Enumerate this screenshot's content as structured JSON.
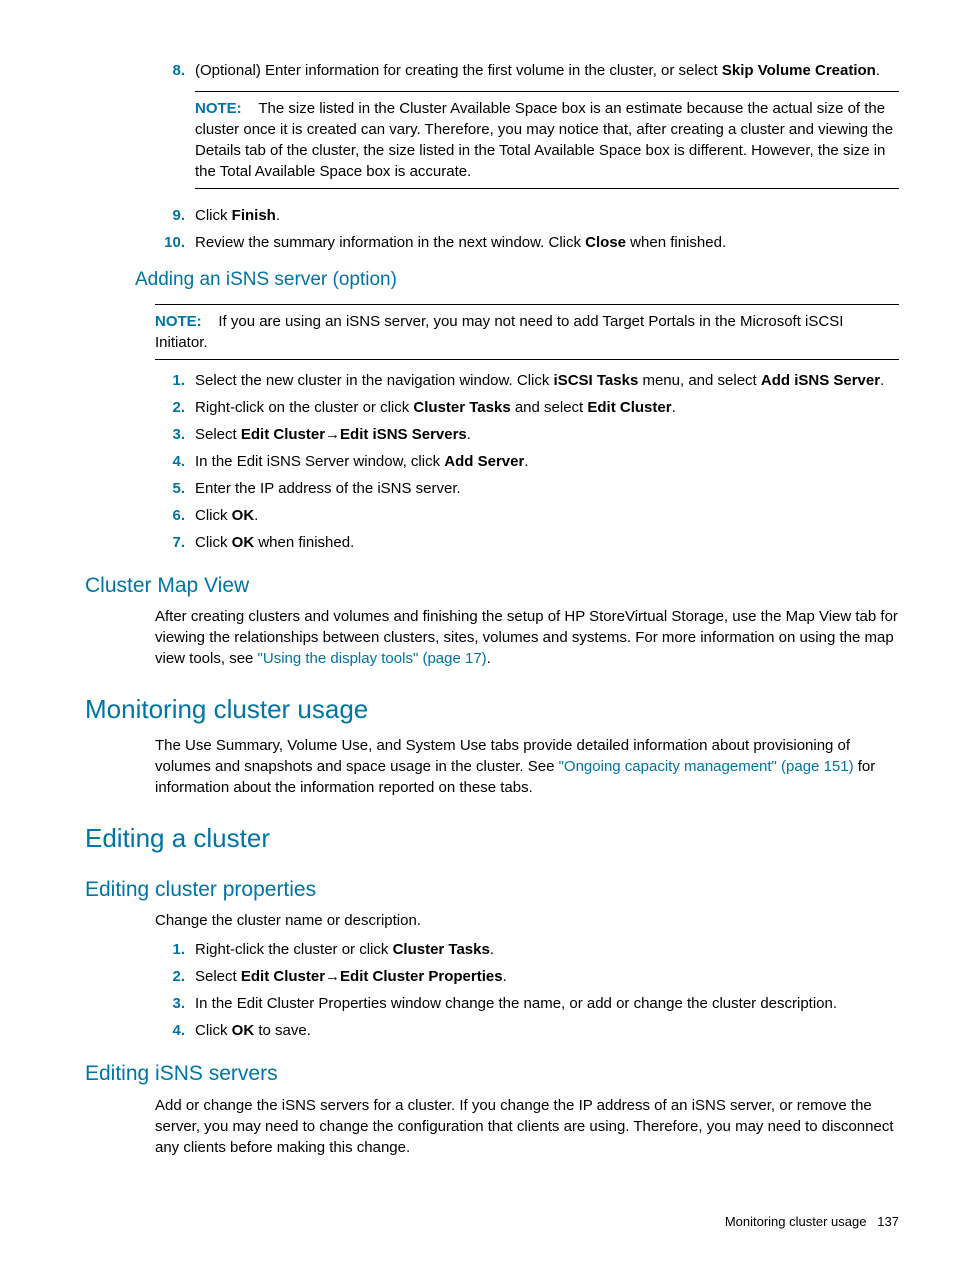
{
  "step8": {
    "num": "8.",
    "pre": "(Optional) Enter information for creating the first volume in the cluster, or select ",
    "bold": "Skip Volume Creation",
    "post": "."
  },
  "note1": {
    "label": "NOTE:",
    "text": "The size listed in the Cluster Available Space box is an estimate because the actual size of the cluster once it is created can vary. Therefore, you may notice that, after creating a cluster and viewing the Details tab of the cluster, the size listed in the Total Available Space box is different. However, the size in the Total Available Space box is accurate."
  },
  "step9": {
    "num": "9.",
    "pre": "Click ",
    "bold": "Finish",
    "post": "."
  },
  "step10": {
    "num": "10.",
    "pre": "Review the summary information in the next window. Click ",
    "bold": "Close",
    "post": " when finished."
  },
  "h_isns": "Adding an iSNS server (option)",
  "note2": {
    "label": "NOTE:",
    "text": "If you are using an iSNS server, you may not need to add Target Portals in the Microsoft iSCSI Initiator."
  },
  "isns1": {
    "num": "1.",
    "pre": "Select the new cluster in the navigation window. Click ",
    "b1": "iSCSI Tasks",
    "mid": " menu, and select ",
    "b2": "Add iSNS Server",
    "post": "."
  },
  "isns2": {
    "num": "2.",
    "pre": "Right-click on the cluster or click ",
    "b1": "Cluster Tasks",
    "mid": " and select ",
    "b2": "Edit Cluster",
    "post": "."
  },
  "isns3": {
    "num": "3.",
    "pre": "Select ",
    "b1": "Edit Cluster",
    "arrow": "→",
    "b2": "Edit iSNS Servers",
    "post": "."
  },
  "isns4": {
    "num": "4.",
    "pre": "In the Edit iSNS Server window, click ",
    "b1": "Add Server",
    "post": "."
  },
  "isns5": {
    "num": "5.",
    "text": "Enter the IP address of the iSNS server."
  },
  "isns6": {
    "num": "6.",
    "pre": "Click ",
    "b1": "OK",
    "post": "."
  },
  "isns7": {
    "num": "7.",
    "pre": "Click ",
    "b1": "OK",
    "post": " when finished."
  },
  "h_map": "Cluster Map View",
  "map_para_pre": "After creating clusters and volumes and finishing the setup of HP StoreVirtual Storage, use the Map View tab for viewing the relationships between clusters, sites, volumes and systems. For more information on using the map view tools, see ",
  "map_link": "\"Using the display tools\" (page 17)",
  "map_para_post": ".",
  "h_mon": "Monitoring cluster usage",
  "mon_para_pre": "The Use Summary, Volume Use, and System Use tabs provide detailed information about provisioning of volumes and snapshots and space usage in the cluster. See ",
  "mon_link": "\"Ongoing capacity management\" (page 151)",
  "mon_para_post": " for information about the information reported on these tabs.",
  "h_edit": "Editing a cluster",
  "h_props": "Editing cluster properties",
  "props_intro": "Change the cluster name or description.",
  "p1": {
    "num": "1.",
    "pre": "Right-click the cluster or click ",
    "b1": "Cluster Tasks",
    "post": "."
  },
  "p2": {
    "num": "2.",
    "pre": "Select ",
    "b1": "Edit Cluster",
    "arrow": "→",
    "b2": "Edit Cluster Properties",
    "post": "."
  },
  "p3": {
    "num": "3.",
    "text": "In the Edit Cluster Properties window change the name, or add or change the cluster description."
  },
  "p4": {
    "num": "4.",
    "pre": "Click ",
    "b1": "OK",
    "post": " to save."
  },
  "h_eisns": "Editing iSNS servers",
  "eisns_para": "Add or change the iSNS servers for a cluster. If you change the IP address of an iSNS server, or remove the server, you may need to change the configuration that clients are using. Therefore, you may need to disconnect any clients before making this change.",
  "footer_text": "Monitoring cluster usage",
  "footer_page": "137"
}
